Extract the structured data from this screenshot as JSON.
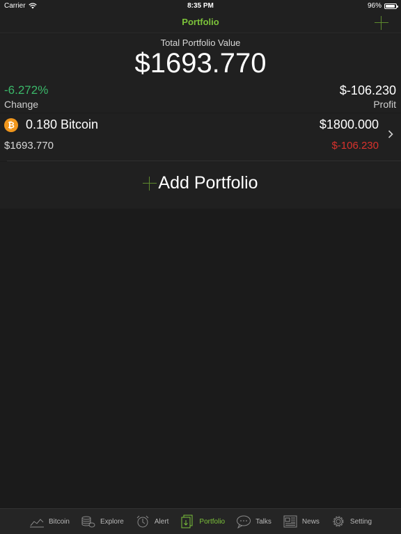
{
  "status_bar": {
    "carrier": "Carrier",
    "time": "8:35 PM",
    "battery": "96%",
    "battery_level": 0.96
  },
  "nav": {
    "title": "Portfolio"
  },
  "summary": {
    "total_label": "Total Portfolio Value",
    "total_value": "$1693.770",
    "change_value": "-6.272%",
    "change_label": "Change",
    "profit_value": "$-106.230",
    "profit_label": "Profit"
  },
  "holdings": [
    {
      "icon": "bitcoin-icon",
      "icon_glyph": "₿",
      "amount": "0.180 Bitcoin",
      "worth": "$1693.770",
      "cost": "$1800.000",
      "profit": "$-106.230"
    }
  ],
  "add_portfolio": {
    "label": "Add Portfolio"
  },
  "tabs": [
    {
      "label": "Bitcoin",
      "icon": "chart-icon",
      "active": false
    },
    {
      "label": "Explore",
      "icon": "coins-icon",
      "active": false
    },
    {
      "label": "Alert",
      "icon": "alarm-clock-icon",
      "active": false
    },
    {
      "label": "Portfolio",
      "icon": "portfolio-icon",
      "active": true
    },
    {
      "label": "Talks",
      "icon": "chat-bubble-icon",
      "active": false
    },
    {
      "label": "News",
      "icon": "newspaper-icon",
      "active": false
    },
    {
      "label": "Setting",
      "icon": "gear-icon",
      "active": false
    }
  ],
  "colors": {
    "accent": "#7cc33a",
    "positive": "#3bb86a",
    "negative": "#d9322d",
    "bitcoin": "#f0961c"
  }
}
